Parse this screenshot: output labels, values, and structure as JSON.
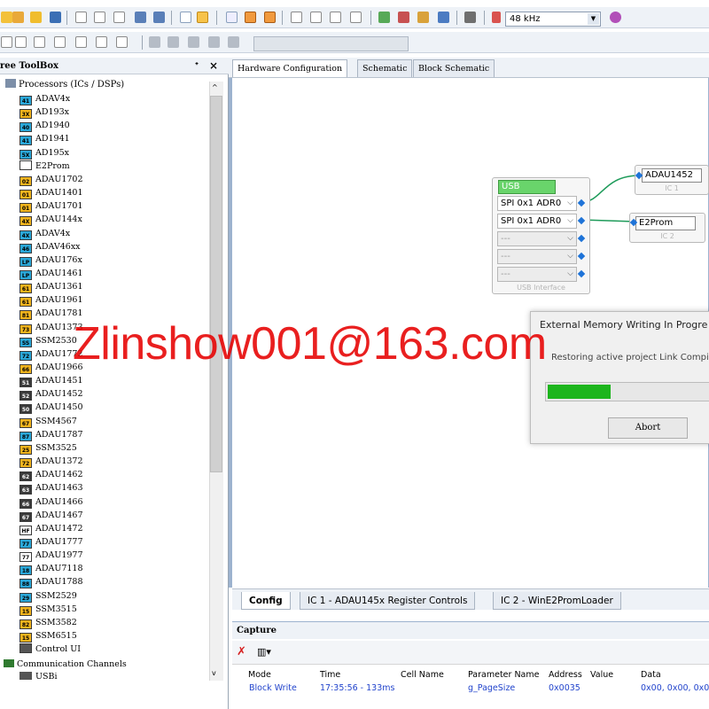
{
  "toolbar": {
    "sample_rate": "48 kHz"
  },
  "toolbox": {
    "title": "ree ToolBox",
    "pin": "ⁱ",
    "close": "×",
    "root": "Processors (ICs / DSPs)",
    "items": [
      {
        "label": "ADAV4x",
        "chip": "41",
        "color": "#2aa7d8"
      },
      {
        "label": "AD193x",
        "chip": "3X",
        "color": "#f2b41d"
      },
      {
        "label": "AD1940",
        "chip": "40",
        "color": "#2aa7d8"
      },
      {
        "label": "AD1941",
        "chip": "41",
        "color": "#2aa7d8"
      },
      {
        "label": "AD195x",
        "chip": "5X",
        "color": "#2aa7d8"
      },
      {
        "label": "E2Prom",
        "chip": "",
        "color": "#ffffff"
      },
      {
        "label": "ADAU1702",
        "chip": "02",
        "color": "#f2b41d"
      },
      {
        "label": "ADAU1401",
        "chip": "01",
        "color": "#f2b41d"
      },
      {
        "label": "ADAU1701",
        "chip": "01",
        "color": "#f2b41d"
      },
      {
        "label": "ADAU144x",
        "chip": "4X",
        "color": "#f2b41d"
      },
      {
        "label": "ADAV4x",
        "chip": "4X",
        "color": "#2aa7d8"
      },
      {
        "label": "ADAV46xx",
        "chip": "46",
        "color": "#2aa7d8"
      },
      {
        "label": "ADAU176x",
        "chip": "LP",
        "color": "#2aa7d8"
      },
      {
        "label": "ADAU1461",
        "chip": "LP",
        "color": "#2aa7d8"
      },
      {
        "label": "ADAU1361",
        "chip": "61",
        "color": "#f2b41d"
      },
      {
        "label": "ADAU1961",
        "chip": "61",
        "color": "#f2b41d"
      },
      {
        "label": "ADAU1781",
        "chip": "81",
        "color": "#f2b41d"
      },
      {
        "label": "ADAU1373",
        "chip": "73",
        "color": "#f2b41d"
      },
      {
        "label": "SSM2530",
        "chip": "SS",
        "color": "#2aa7d8"
      },
      {
        "label": "ADAU1772",
        "chip": "72",
        "color": "#2aa7d8"
      },
      {
        "label": "ADAU1966",
        "chip": "66",
        "color": "#f2b41d"
      },
      {
        "label": "ADAU1451",
        "chip": "51",
        "color": "#3a3a3a"
      },
      {
        "label": "ADAU1452",
        "chip": "52",
        "color": "#3a3a3a"
      },
      {
        "label": "ADAU1450",
        "chip": "50",
        "color": "#3a3a3a"
      },
      {
        "label": "SSM4567",
        "chip": "67",
        "color": "#f2b41d"
      },
      {
        "label": "ADAU1787",
        "chip": "87",
        "color": "#2aa7d8"
      },
      {
        "label": "SSM3525",
        "chip": "25",
        "color": "#f2b41d"
      },
      {
        "label": "ADAU1372",
        "chip": "72",
        "color": "#f2b41d"
      },
      {
        "label": "ADAU1462",
        "chip": "62",
        "color": "#3a3a3a"
      },
      {
        "label": "ADAU1463",
        "chip": "63",
        "color": "#3a3a3a"
      },
      {
        "label": "ADAU1466",
        "chip": "66",
        "color": "#3a3a3a"
      },
      {
        "label": "ADAU1467",
        "chip": "67",
        "color": "#3a3a3a"
      },
      {
        "label": "ADAU1472",
        "chip": "HF",
        "color": "#ffffff"
      },
      {
        "label": "ADAU1777",
        "chip": "77",
        "color": "#2aa7d8"
      },
      {
        "label": "ADAU1977",
        "chip": "77",
        "color": "#ffffff"
      },
      {
        "label": "ADAU7118",
        "chip": "18",
        "color": "#2aa7d8"
      },
      {
        "label": "ADAU1788",
        "chip": "88",
        "color": "#2aa7d8"
      },
      {
        "label": "SSM2529",
        "chip": "29",
        "color": "#2aa7d8"
      },
      {
        "label": "SSM3515",
        "chip": "15",
        "color": "#f2b41d"
      },
      {
        "label": "SSM3582",
        "chip": "82",
        "color": "#f2b41d"
      },
      {
        "label": "SSM6515",
        "chip": "15",
        "color": "#f2b41d"
      },
      {
        "label": "Control UI",
        "chip": "",
        "color": "#555555"
      }
    ],
    "root2": "Communication Channels",
    "root2_child": "USBi"
  },
  "tabs": [
    {
      "label": "Hardware Configuration"
    },
    {
      "label": "Schematic"
    },
    {
      "label": "Block Schematic"
    }
  ],
  "usb": {
    "title": "USB",
    "ports": [
      "SPI 0x1 ADR0",
      "SPI 0x1 ADR0",
      "---",
      "---",
      "---"
    ],
    "caption": "USB Interface"
  },
  "ic1": {
    "name": "ADAU1452",
    "caption": "IC 1"
  },
  "ic2": {
    "name": "E2Prom",
    "caption": "IC 2"
  },
  "dialog": {
    "title": "External Memory Writing In Progre",
    "message": "Restoring active project Link Compi",
    "progress": 0.38,
    "abort": "Abort"
  },
  "bottom_tabs": [
    {
      "label": "Config"
    },
    {
      "label": "IC 1 - ADAU145x Register Controls"
    },
    {
      "label": "IC 2 - WinE2PromLoader"
    }
  ],
  "capture": {
    "title": "Capture",
    "columns": [
      "Mode",
      "Time",
      "Cell Name",
      "Parameter Name",
      "Address",
      "Value",
      "Data"
    ],
    "rows": [
      {
        "mode": "Block Write",
        "time": "17:35:56 - 133ms",
        "param": "g_PageSize",
        "address": "0x0035",
        "data": "0x00, 0x00, 0x0"
      }
    ]
  },
  "watermark": "Zlinshow001@163.com"
}
